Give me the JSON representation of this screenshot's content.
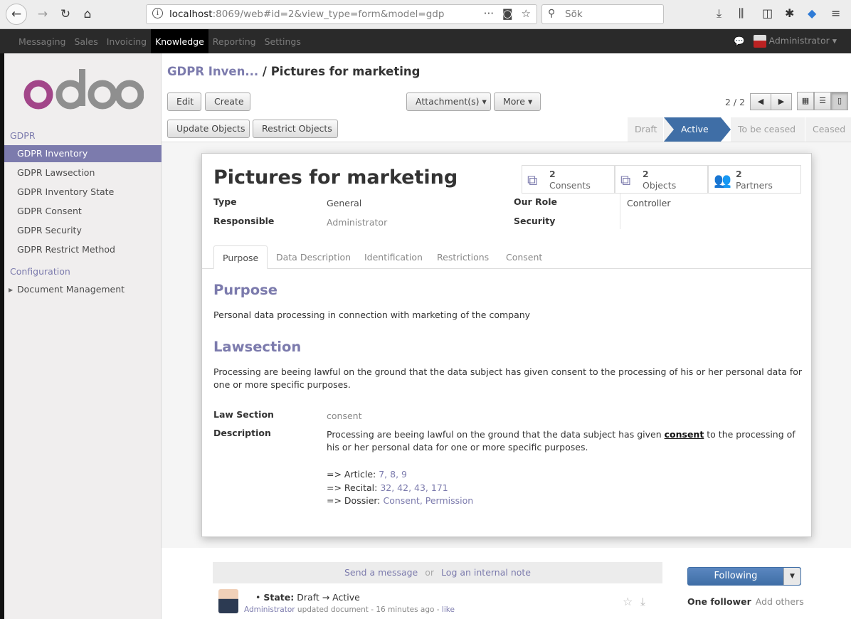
{
  "browser": {
    "url_host": "localhost",
    "url_rest": ":8069/web#id=2&view_type=form&model=gdp",
    "search_placeholder": "Sök"
  },
  "topnav": {
    "apps": [
      "Messaging",
      "Sales",
      "Invoicing",
      "Knowledge",
      "Reporting",
      "Settings"
    ],
    "active_app": "Knowledge",
    "user": "Administrator"
  },
  "sidebar": {
    "logo": "odoo",
    "section1": "GDPR",
    "items": [
      "GDPR Inventory",
      "GDPR Lawsection",
      "GDPR Inventory State",
      "GDPR Consent",
      "GDPR Security",
      "GDPR Restrict Method"
    ],
    "section2": "Configuration",
    "config_items": [
      "Document Management"
    ]
  },
  "breadcrumb": {
    "parent": "GDPR Inven...",
    "sep": "/",
    "current": "Pictures for marketing"
  },
  "buttons": {
    "edit": "Edit",
    "create": "Create",
    "attachments": "Attachment(s) ▾",
    "more": "More ▾",
    "update_objects": "Update Objects",
    "restrict_objects": "Restrict Objects"
  },
  "pager": {
    "value": "2 / 2"
  },
  "stages": [
    "Draft",
    "Active",
    "To be ceased",
    "Ceased"
  ],
  "active_stage": "Active",
  "record": {
    "name": "Pictures for marketing",
    "smart_buttons": [
      {
        "count": "2",
        "label": "Consents"
      },
      {
        "count": "2",
        "label": "Objects"
      },
      {
        "count": "2",
        "label": "Partners"
      }
    ],
    "fields": {
      "type_label": "Type",
      "type_value": "General",
      "responsible_label": "Responsible",
      "responsible_value": "Administrator",
      "role_label": "Our Role",
      "role_value": "Controller",
      "security_label": "Security"
    },
    "tabs": [
      "Purpose",
      "Data Description",
      "Identification",
      "Restrictions",
      "Consent"
    ],
    "purpose_heading": "Purpose",
    "purpose_text": "Personal data processing in connection with marketing of the company",
    "lawsection_heading": "Lawsection",
    "lawsection_text": "Processing are beeing lawful on the ground that the data subject has given consent to the processing of his or her personal data for one or more specific purposes.",
    "law_section_label": "Law Section",
    "law_section_value": "consent",
    "description_label": "Description",
    "description_pre": "Processing are beeing lawful on the ground that the data subject has given ",
    "description_bold": "consent",
    "description_post": " to the processing of his or her personal data for one or more specific purposes.",
    "article_label": "=> Article: ",
    "article_refs": "7, 8, 9",
    "recital_label": "=> Recital: ",
    "recital_refs": "32, 42, 43, 171",
    "dossier_label": "=> Dossier: ",
    "dossier_refs": "Consent, Permission"
  },
  "chatter": {
    "send_message": "Send a message",
    "or": "or",
    "log_note": "Log an internal note",
    "following": "Following",
    "one_follower": "One follower",
    "add_others": "Add others",
    "msg_state_label": "State:",
    "msg_state_change": "Draft → Active",
    "msg_author": "Administrator",
    "msg_meta": "updated document - 16 minutes ago -",
    "msg_tail": "like"
  }
}
